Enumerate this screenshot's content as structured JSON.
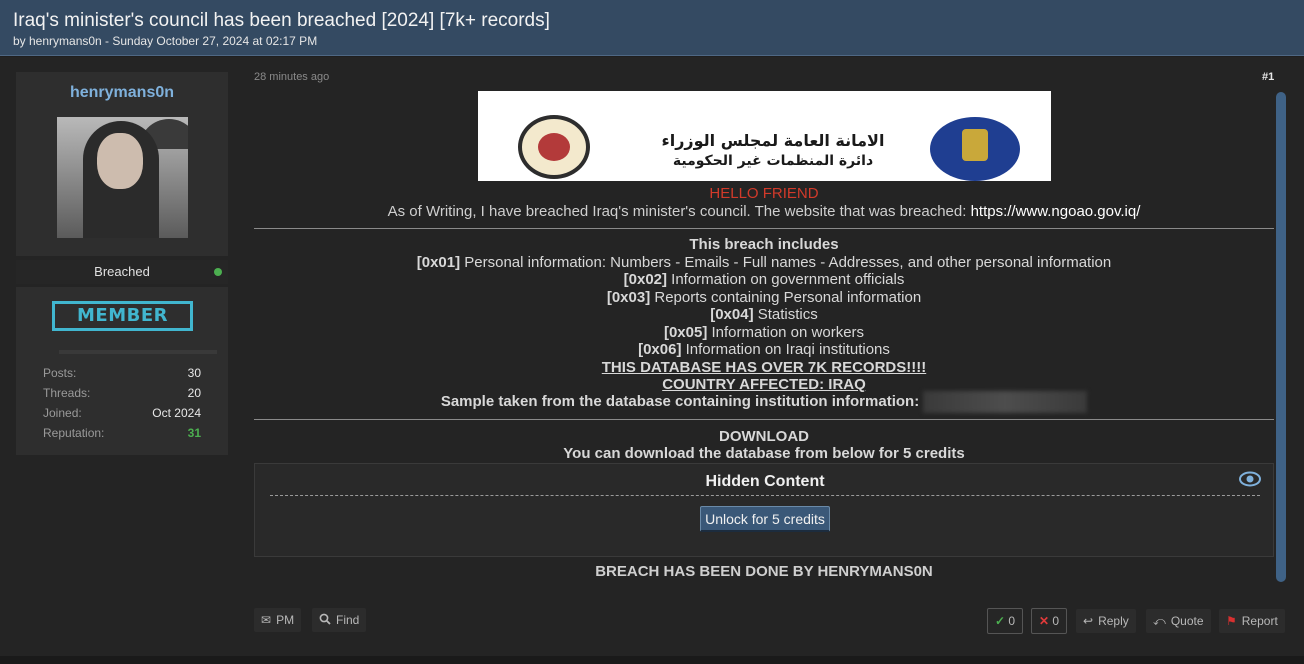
{
  "thread": {
    "title": "Iraq's minister's council has been breached [2024] [7k+ records]",
    "byline": "by henrymans0n - Sunday October 27, 2024 at 02:17 PM"
  },
  "user": {
    "username": "henrymans0n",
    "status": "Breached",
    "rank_badge": "MEMBER",
    "stats": [
      {
        "label": "Posts:",
        "value": "30"
      },
      {
        "label": "Threads:",
        "value": "20"
      },
      {
        "label": "Joined:",
        "value": "Oct 2024"
      },
      {
        "label": "Reputation:",
        "value": "31"
      }
    ]
  },
  "post": {
    "time": "28 minutes ago",
    "number": "#1",
    "banner": {
      "arabic_line1": "الامانة العامة لمجلس الوزراء",
      "arabic_line2": "دائرة المنظمات غير الحكومية"
    },
    "hello": "HELLO FRIEND",
    "intro_text": "As of Writing, I have breached Iraq's minister's council. The website that was breached: ",
    "intro_url": "https://www.ngoao.gov.iq/",
    "includes_heading": "This breach includes",
    "items": [
      {
        "code": "[0x01]",
        "text": " Personal information: Numbers - Emails - Full names - Addresses, and other personal information"
      },
      {
        "code": "[0x02]",
        "text": " Information on government officials"
      },
      {
        "code": "[0x03]",
        "text": " Reports containing Personal information"
      },
      {
        "code": "[0x04]",
        "text": " Statistics"
      },
      {
        "code": "[0x05]",
        "text": " Information on workers"
      },
      {
        "code": "[0x06]",
        "text": " Information on Iraqi institutions"
      }
    ],
    "records_line": "THIS DATABASE HAS OVER 7K RECORDS!!!!",
    "country_line": "COUNTRY AFFECTED: IRAQ",
    "sample_line": "Sample taken from the database containing institution information:",
    "download_heading": "DOWNLOAD",
    "download_text": "You can download the database from below for 5 credits",
    "hidden_title": "Hidden Content",
    "unlock_label": "Unlock for 5 credits",
    "signoff": "BREACH HAS BEEN DONE BY HENRYMANS0N"
  },
  "footer": {
    "pm": "PM",
    "find": "Find",
    "upvotes": "0",
    "downvotes": "0",
    "reply": "Reply",
    "quote": "Quote",
    "report": "Report"
  },
  "colors": {
    "header_bg": "#344a62",
    "username": "#7fb1dc",
    "hello": "#d23a2a",
    "badge": "#41b6cf",
    "online": "#4caf50",
    "unlock_button": "#3a5878"
  }
}
